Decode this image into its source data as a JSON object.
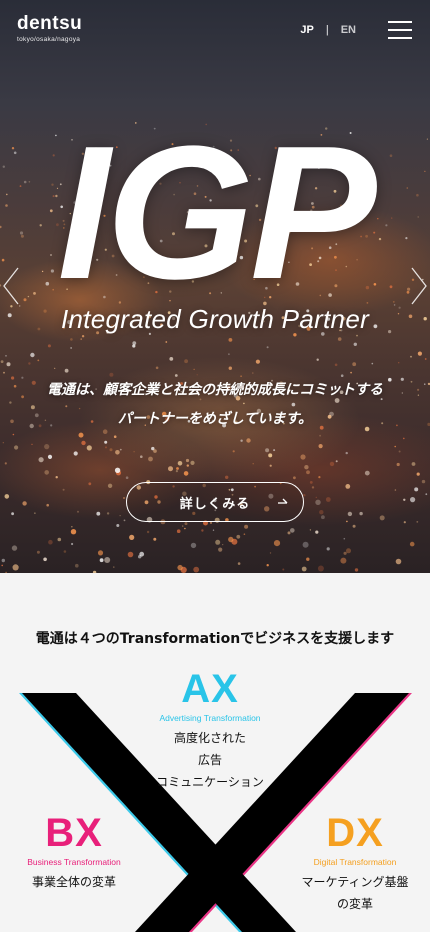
{
  "header": {
    "logo_name": "dentsu",
    "logo_sub": "tokyo/osaka/nagoya",
    "lang_jp": "JP",
    "lang_sep": "|",
    "lang_en": "EN"
  },
  "hero": {
    "title": "IGP",
    "subtitle": "Integrated Growth Partner",
    "lead_line1": "電通は、顧客企業と社会の持続的成長にコミットする",
    "lead_line2": "パートナーをめざしています。",
    "button_label": "詳しくみる"
  },
  "transformation": {
    "heading": "電通は４つのTransformationでビジネスを支援します",
    "ax": {
      "code": "AX",
      "english": "Advertising Transformation",
      "jp_line1": "高度化された",
      "jp_line2": "広告",
      "jp_line3": "コミュニケーション",
      "color": "#29c4e8"
    },
    "bx": {
      "code": "BX",
      "english": "Business Transformation",
      "jp_line1": "事業全体の変革",
      "color": "#e8207a"
    },
    "dx": {
      "code": "DX",
      "english": "Digital Transformation",
      "jp_line1": "マーケティング基盤",
      "jp_line2": "の変革",
      "color": "#f5a020"
    }
  },
  "icons": [
    "menu-icon",
    "chevron-left-icon",
    "chevron-right-icon",
    "arrow-right-icon"
  ]
}
